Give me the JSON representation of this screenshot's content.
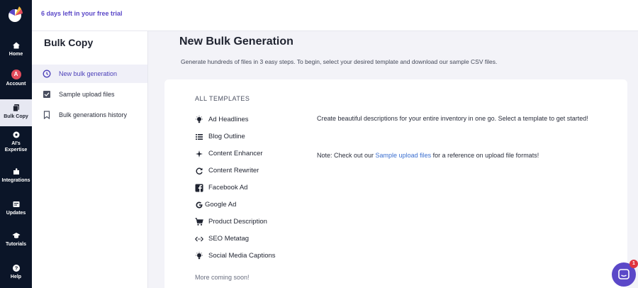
{
  "topbar": {
    "trial_text": "6 days left in your free trial"
  },
  "rail": {
    "items": [
      {
        "label": "Home"
      },
      {
        "label": "Account",
        "avatar_letter": "A"
      },
      {
        "label": "Bulk Copy"
      },
      {
        "label": "AI's Expertise"
      },
      {
        "label": "Integrations"
      },
      {
        "label": "Updates"
      },
      {
        "label": "Tutorials"
      },
      {
        "label": "Help"
      }
    ]
  },
  "sidebar": {
    "title": "Bulk Copy",
    "items": [
      {
        "label": "New bulk generation",
        "icon": "clock-icon"
      },
      {
        "label": "Sample upload files",
        "icon": "checkbox-icon"
      },
      {
        "label": "Bulk generations history",
        "icon": "bookmark-icon"
      }
    ]
  },
  "main": {
    "title": "New Bulk Generation",
    "subtitle": "Generate hundreds of files in 3 easy steps. To begin, select your desired template and download our sample CSV files.",
    "templates_heading": "ALL TEMPLATES",
    "templates": [
      {
        "label": "Ad Headlines",
        "icon": "lightbulb-icon"
      },
      {
        "label": "Blog Outline",
        "icon": "list-icon"
      },
      {
        "label": "Content Enhancer",
        "icon": "sparkle-icon"
      },
      {
        "label": "Content Rewriter",
        "icon": "refresh-icon"
      },
      {
        "label": "Facebook Ad",
        "icon": "facebook-icon"
      },
      {
        "label": "Google Ad",
        "icon": "google-icon"
      },
      {
        "label": "Product Description",
        "icon": "cart-icon"
      },
      {
        "label": "SEO Metatag",
        "icon": "code-icon"
      },
      {
        "label": "Social Media Captions",
        "icon": "lightbulb-icon"
      }
    ],
    "more_text": "More coming soon!",
    "description": "Create beautiful descriptions for your entire inventory in one go. Select a template to get started!",
    "note_prefix": "Note: Check out our ",
    "note_link": "Sample upload files",
    "note_suffix": " for a reference on upload file formats!"
  },
  "chat": {
    "badge_count": "1"
  },
  "colors": {
    "rail_bg": "#0b1528",
    "accent": "#5b48c8",
    "link": "#3b6fd0",
    "badge": "#e0343f"
  }
}
